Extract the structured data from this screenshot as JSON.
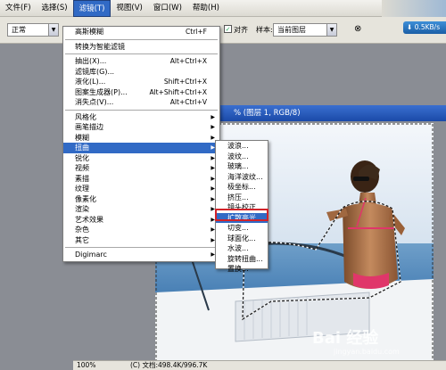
{
  "menubar": {
    "items": [
      {
        "label": "文件(F)"
      },
      {
        "label": "选择(S)"
      },
      {
        "label": "滤镜(T)",
        "active": true
      },
      {
        "label": "视图(V)"
      },
      {
        "label": "窗口(W)"
      },
      {
        "label": "帮助(H)"
      }
    ]
  },
  "options": {
    "blend_mode": "正常",
    "align_label": "对齐",
    "sample_label": "样本:",
    "sample_value": "当前图层",
    "size_badge": "0.5KB/s"
  },
  "document": {
    "title": "% (图层 1, RGB/8)",
    "zoom": "100%",
    "doc_info": "(C) 文档:498.4K/996.7K"
  },
  "filter_menu": {
    "items": [
      {
        "label": "高斯模糊",
        "shortcut": "Ctrl+F"
      },
      {
        "sep": true
      },
      {
        "label": "转换为智能滤镜"
      },
      {
        "sep": true
      },
      {
        "label": "抽出(X)...",
        "shortcut": "Alt+Ctrl+X"
      },
      {
        "label": "滤镜库(G)..."
      },
      {
        "label": "液化(L)...",
        "shortcut": "Shift+Ctrl+X"
      },
      {
        "label": "图案生成器(P)...",
        "shortcut": "Alt+Shift+Ctrl+X"
      },
      {
        "label": "消失点(V)...",
        "shortcut": "Alt+Ctrl+V"
      },
      {
        "sep": true
      },
      {
        "label": "风格化",
        "sub": true
      },
      {
        "label": "画笔描边",
        "sub": true
      },
      {
        "label": "模糊",
        "sub": true
      },
      {
        "label": "扭曲",
        "sub": true,
        "highlight": true
      },
      {
        "label": "锐化",
        "sub": true
      },
      {
        "label": "视频",
        "sub": true
      },
      {
        "label": "素描",
        "sub": true
      },
      {
        "label": "纹理",
        "sub": true
      },
      {
        "label": "像素化",
        "sub": true
      },
      {
        "label": "渲染",
        "sub": true
      },
      {
        "label": "艺术效果",
        "sub": true
      },
      {
        "label": "杂色",
        "sub": true
      },
      {
        "label": "其它",
        "sub": true
      },
      {
        "sep": true
      },
      {
        "label": "Digimarc",
        "sub": true
      }
    ]
  },
  "distort_menu": {
    "items": [
      {
        "label": "波浪..."
      },
      {
        "label": "波纹..."
      },
      {
        "label": "玻璃..."
      },
      {
        "label": "海洋波纹..."
      },
      {
        "label": "极坐标..."
      },
      {
        "label": "挤压..."
      },
      {
        "label": "镜头校正..."
      },
      {
        "label": "扩散亮光...",
        "highlight": true
      },
      {
        "label": "切变..."
      },
      {
        "label": "球面化..."
      },
      {
        "label": "水波..."
      },
      {
        "label": "旋转扭曲..."
      },
      {
        "label": "置换..."
      }
    ]
  },
  "watermark": {
    "text": "Bai 经验",
    "url": "jingyan.baidu.com"
  }
}
